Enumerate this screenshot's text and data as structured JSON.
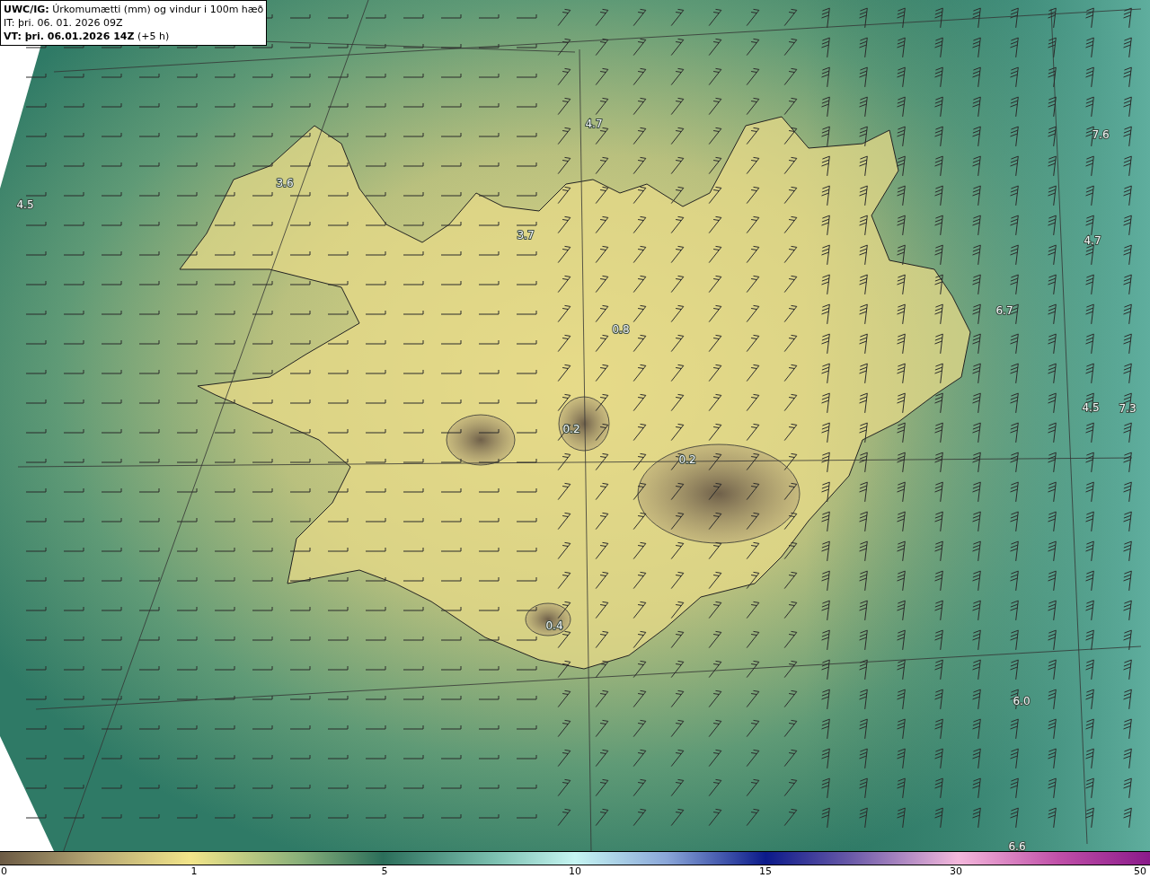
{
  "title_box": {
    "model": "UWC/IG:",
    "description": "Úrkomumætti (mm) og vindur i 100m hæð",
    "issue_time": "IT: þri. 06. 01. 2026 09Z",
    "valid_time": "VT: þri. 06.01.2026 14Z",
    "offset": "(+5 h)"
  },
  "map": {
    "value_labels": [
      "4.7",
      "3.6",
      "4.5",
      "3.7",
      "7.6",
      "4.7",
      "6.7",
      "0.8",
      "4.5",
      "7.3",
      "0.2",
      "0.2",
      "0.4",
      "6.0",
      "6.6"
    ]
  },
  "colorbar": {
    "ticks": [
      "0",
      "1",
      "5",
      "10",
      "15",
      "30",
      "50"
    ]
  }
}
